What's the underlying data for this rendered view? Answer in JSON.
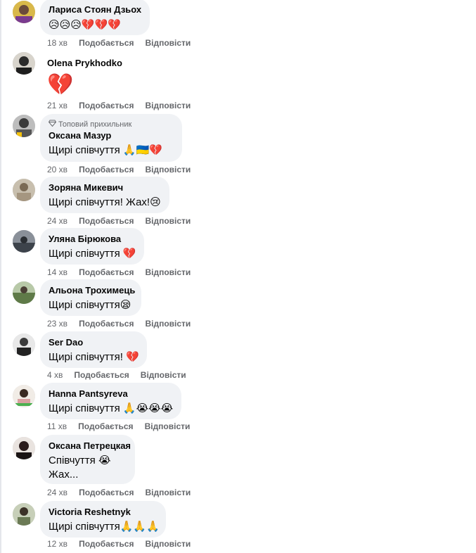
{
  "comments": [
    {
      "author": "Лариса Стоян Дзьох",
      "text": "",
      "emoji": "😥😥😥💔💔💔",
      "time": "18 хв",
      "avatar_color": "#c9a23a"
    },
    {
      "author": "Olena Prykhodko",
      "text": "",
      "emoji": "💔",
      "time": "21 хв",
      "avatar_color": "#3b3b3b"
    },
    {
      "author": "Оксана Мазур",
      "badge": "Топовий прихильник",
      "text": "Щирі співчуття ",
      "emoji": "🙏🇺🇦💔",
      "time": "20 хв",
      "avatar_color": "#5a5a5a"
    },
    {
      "author": "Зоряна Микевич",
      "text": "Щирі співчуття! Жах!",
      "emoji": "😢",
      "time": "24 хв",
      "avatar_color": "#9e8f7a"
    },
    {
      "author": "Уляна Бірюкова",
      "text": "Щирі співчуття ",
      "emoji": "💔",
      "time": "14 хв",
      "avatar_color": "#4e5560"
    },
    {
      "author": "Альона Трохимець",
      "text": "Щирі співчуття",
      "emoji": "😪",
      "time": "23 хв",
      "avatar_color": "#6f8a5a"
    },
    {
      "author": "Ser Dao",
      "text": "Щирі співчуття! ",
      "emoji": "💔",
      "time": "4 хв",
      "avatar_color": "#2f2f2f"
    },
    {
      "author": "Hanna Pantsyreva",
      "text": "Щирі співчуття ",
      "emoji": "🙏😭😭😭",
      "time": "11 хв",
      "avatar_color": "#a05050"
    },
    {
      "author": "Оксана Петрецкая",
      "text": "Співчуття ",
      "emoji": "😭",
      "text2": "Жах...",
      "time": "24 хв",
      "avatar_color": "#3a3030"
    },
    {
      "author": "Victoria Reshetnyk",
      "text": "Щирі співчуття",
      "emoji": "🙏🙏🙏",
      "time": "12 хв",
      "avatar_color": "#5f6b50"
    }
  ],
  "actions": {
    "like": "Подобається",
    "reply": "Відповісти"
  }
}
